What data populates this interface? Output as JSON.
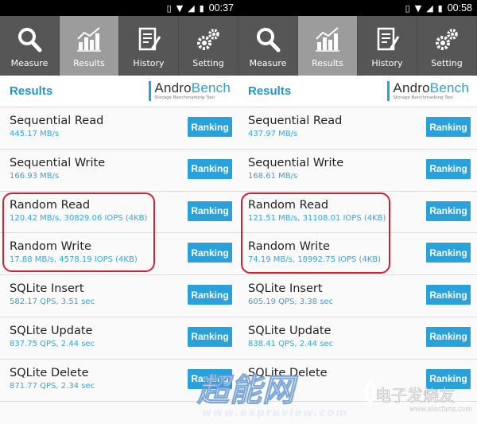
{
  "screens": [
    {
      "status_time": "00:37",
      "tabs": [
        {
          "label": "Measure",
          "icon": "magnifier-icon"
        },
        {
          "label": "Results",
          "icon": "chart-icon"
        },
        {
          "label": "History",
          "icon": "document-icon"
        },
        {
          "label": "Setting",
          "icon": "gears-icon"
        }
      ],
      "header": {
        "title": "Results",
        "logo_main_a": "Andro",
        "logo_main_b": "Bench",
        "logo_sub": "Storage Benchmarking Tool"
      },
      "rows": [
        {
          "title": "Sequential Read",
          "value": "445.17 MB/s",
          "button": "Ranking"
        },
        {
          "title": "Sequential Write",
          "value": "166.93 MB/s",
          "button": "Ranking"
        },
        {
          "title": "Random Read",
          "value": "120.42 MB/s, 30829.06 IOPS (4KB)",
          "button": "Ranking"
        },
        {
          "title": "Random Write",
          "value": "17.88 MB/s, 4578.19 IOPS (4KB)",
          "button": "Ranking"
        },
        {
          "title": "SQLite Insert",
          "value": "582.17 QPS, 3.51 sec",
          "button": "Ranking"
        },
        {
          "title": "SQLite Update",
          "value": "837.75 QPS, 2.44 sec",
          "button": "Ranking"
        },
        {
          "title": "SQLite Delete",
          "value": "871.77 QPS, 2.34 sec",
          "button": "Ranking"
        }
      ]
    },
    {
      "status_time": "00:58",
      "tabs": [
        {
          "label": "Measure",
          "icon": "magnifier-icon"
        },
        {
          "label": "Results",
          "icon": "chart-icon"
        },
        {
          "label": "History",
          "icon": "document-icon"
        },
        {
          "label": "Setting",
          "icon": "gears-icon"
        }
      ],
      "header": {
        "title": "Results",
        "logo_main_a": "Andro",
        "logo_main_b": "Bench",
        "logo_sub": "Storage Benchmarking Tool"
      },
      "rows": [
        {
          "title": "Sequential Read",
          "value": "437.97 MB/s",
          "button": "Ranking"
        },
        {
          "title": "Sequential Write",
          "value": "168.61 MB/s",
          "button": "Ranking"
        },
        {
          "title": "Random Read",
          "value": "121.51 MB/s, 31108.01 IOPS (4KB)",
          "button": "Ranking"
        },
        {
          "title": "Random Write",
          "value": "74.19 MB/s, 18992.75 IOPS (4KB)",
          "button": "Ranking"
        },
        {
          "title": "SQLite Insert",
          "value": "605.19 QPS, 3.38 sec",
          "button": "Ranking"
        },
        {
          "title": "SQLite Update",
          "value": "838.41 QPS, 2.44 sec",
          "button": "Ranking"
        },
        {
          "title": "SQLite Delete",
          "value": "",
          "button": "Ranking"
        }
      ]
    }
  ],
  "watermarks": {
    "expreview_cn": "超能网",
    "expreview_url": "www.expreview.com",
    "elecfans_cn": "电子发烧友",
    "elecfans_url": "www.elecfans.com"
  },
  "colors": {
    "accent": "#29a2dc",
    "tabbar": "#565656",
    "tab_active": "#9c9c9c",
    "highlight": "#d2202e"
  }
}
